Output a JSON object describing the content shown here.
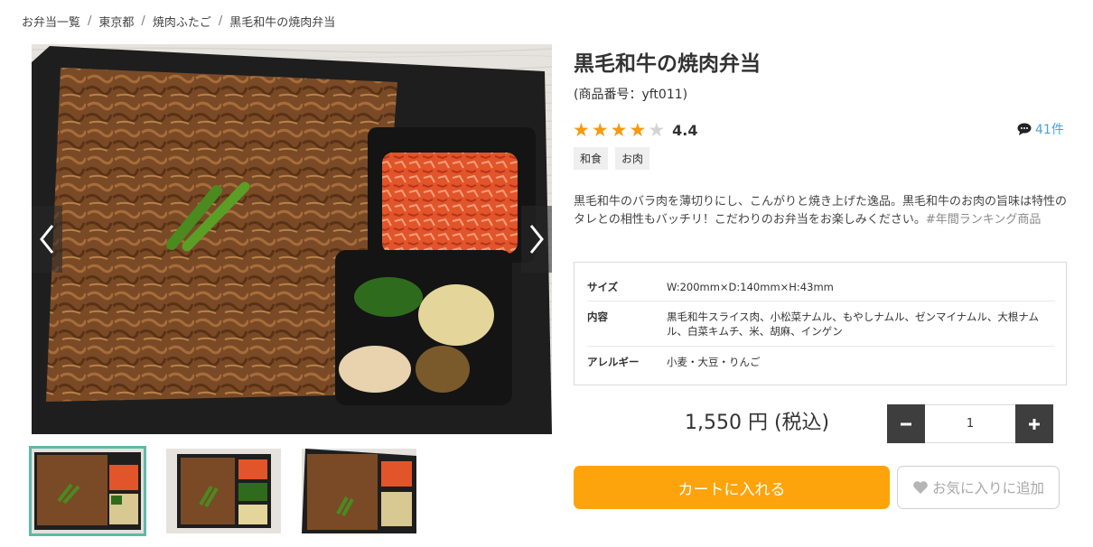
{
  "breadcrumb": [
    "お弁当一覧",
    "東京都",
    "焼肉ふたご",
    "黒毛和牛の焼肉弁当"
  ],
  "product": {
    "title": "黒毛和牛の焼肉弁当",
    "code": "(商品番号：yft011)",
    "rating": 4.4,
    "rating_text": "4.4",
    "stars_filled": 4,
    "stars_total": 5,
    "review_count": "41件",
    "tags": [
      "和食",
      "お肉"
    ],
    "description": "黒毛和牛のバラ肉を薄切りにし、こんがりと焼き上げた逸品。黒毛和牛のお肉の旨味は特性のタレとの相性もバッチリ！こだわりのお弁当をお楽しみください。",
    "hashtag": "#年間ランキング商品",
    "specs": [
      {
        "key": "サイズ",
        "value": "W:200mm×D:140mm×H:43mm"
      },
      {
        "key": "内容",
        "value": "黒毛和牛スライス肉、小松菜ナムル、もやしナムル、ゼンマイナムル、大根ナムル、白菜キムチ、米、胡麻、インゲン"
      },
      {
        "key": "アレルギー",
        "value": "小麦・大豆・りんご"
      }
    ],
    "price": "1,550 円 (税込)",
    "quantity": "1"
  },
  "buttons": {
    "cart": "カートに入れる",
    "favorite": "お気に入りに追加"
  },
  "icons": {
    "prev": "chevron-left-icon",
    "next": "chevron-right-icon",
    "comment": "comment-icon",
    "heart": "heart-icon",
    "minus": "minus-icon",
    "plus": "plus-icon"
  },
  "colors": {
    "star": "#f59a10",
    "cart": "#fda40c",
    "link": "#4aa3d8",
    "thumb_active": "#5fb8a9"
  }
}
